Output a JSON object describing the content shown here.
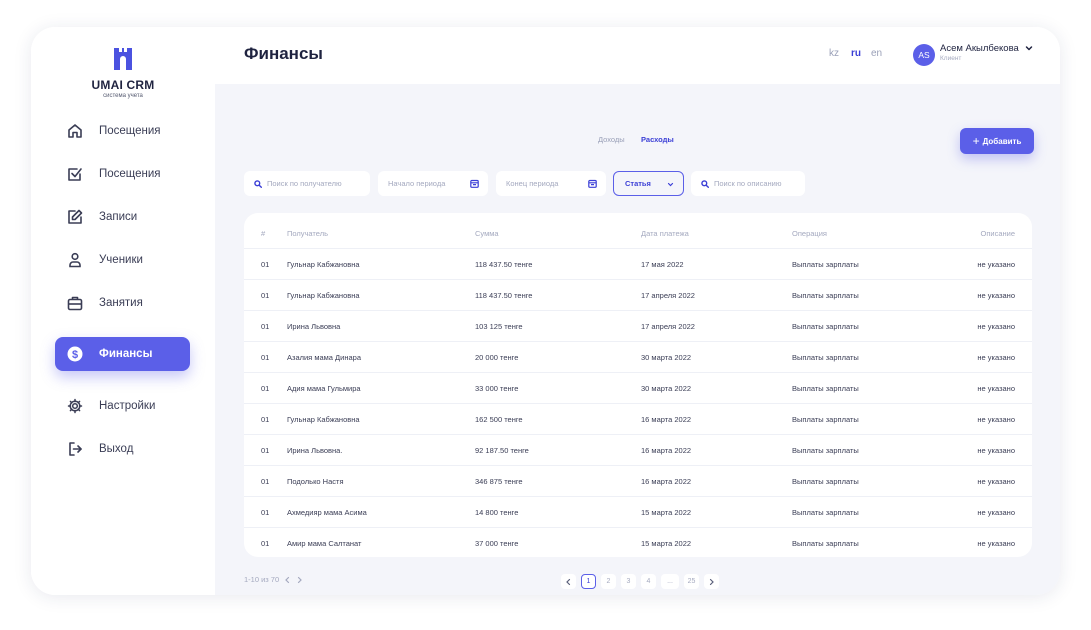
{
  "brand": {
    "title": "UMAI CRM",
    "subtitle": "система учета",
    "color": "#5b5fe8"
  },
  "sidebar": {
    "items": [
      {
        "label": "Посещения",
        "icon": "home-icon",
        "active": false
      },
      {
        "label": "Посещения",
        "icon": "checkbox-icon",
        "active": false
      },
      {
        "label": "Записи",
        "icon": "edit-icon",
        "active": false
      },
      {
        "label": "Ученики",
        "icon": "user-icon",
        "active": false
      },
      {
        "label": "Занятия",
        "icon": "briefcase-icon",
        "active": false
      },
      {
        "label": "Финансы",
        "icon": "dollar-icon",
        "active": true
      },
      {
        "label": "Настройки",
        "icon": "gear-icon",
        "active": false
      },
      {
        "label": "Выход",
        "icon": "logout-icon",
        "active": false
      }
    ]
  },
  "header": {
    "title": "Финансы",
    "languages": [
      "kz",
      "ru",
      "en"
    ],
    "active_language": "ru",
    "user": {
      "initials": "AS",
      "name": "Асем Акылбекова",
      "role": "Клиент"
    }
  },
  "tabs": {
    "income": "Доходы",
    "expenses": "Расходы",
    "active": "Расходы"
  },
  "add_button": {
    "label": "Добавить"
  },
  "filters": {
    "recipient_search": "Поиск по получателю",
    "period_start": "Начало периода",
    "period_end": "Конец периода",
    "category": "Статья",
    "description_search": "Поиск по описанию"
  },
  "table": {
    "columns": [
      "#",
      "Получатель",
      "Сумма",
      "Дата платежа",
      "Операция",
      "Описание"
    ],
    "rows": [
      [
        "01",
        "Гульнар Кабжановна",
        "118 437.50 тенге",
        "17 мая 2022",
        "Выплаты зарплаты",
        "не указано"
      ],
      [
        "01",
        "Гульнар Кабжановна",
        "118 437.50 тенге",
        "17 апреля 2022",
        "Выплаты зарплаты",
        "не указано"
      ],
      [
        "01",
        "Ирина Львовна",
        "103 125 тенге",
        "17 апреля 2022",
        "Выплаты зарплаты",
        "не указано"
      ],
      [
        "01",
        "Азалия мама Динара",
        "20 000 тенге",
        "30 марта 2022",
        "Выплаты зарплаты",
        "не указано"
      ],
      [
        "01",
        "Адия мама Гульмира",
        "33 000 тенге",
        "30 марта 2022",
        "Выплаты зарплаты",
        "не указано"
      ],
      [
        "01",
        "Гульнар Кабжановна",
        "162 500 тенге",
        "16 марта 2022",
        "Выплаты зарплаты",
        "не указано"
      ],
      [
        "01",
        "Ирина Львовна.",
        "92 187.50 тенге",
        "16 марта 2022",
        "Выплаты зарплаты",
        "не указано"
      ],
      [
        "01",
        "Подолько Настя",
        "346 875 тенге",
        "16 марта 2022",
        "Выплаты зарплаты",
        "не указано"
      ],
      [
        "01",
        "Ахмедияр мама Асима",
        "14 800 тенге",
        "15 марта 2022",
        "Выплаты зарплаты",
        "не указано"
      ],
      [
        "01",
        "Амир мама Салтанат",
        "37 000 тенге",
        "15 марта 2022",
        "Выплаты зарплаты",
        "не указано"
      ]
    ]
  },
  "pagination": {
    "range": "1-10 из 70",
    "pages": [
      "1",
      "2",
      "3",
      "4",
      "...",
      "25"
    ],
    "current": "1"
  }
}
